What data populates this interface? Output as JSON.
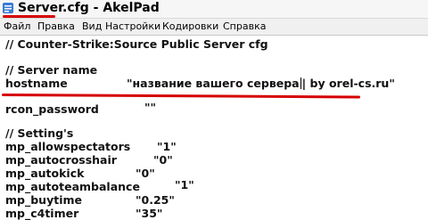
{
  "window": {
    "title_file": "Server.cfg",
    "title_sep": " - ",
    "title_app": "AkelPad",
    "accent_underline_color": "#d60000"
  },
  "menu": [
    "Файл",
    "Правка",
    "Вид",
    "Настройки",
    "Кодировки",
    "Справка"
  ],
  "editor": {
    "header_comment": "// Counter-Strike:Source Public Server cfg",
    "server_name_comment": "// Server name",
    "hostname_key": "hostname",
    "hostname_value_before_caret": "\"название вашего сервера",
    "hostname_value_after_caret": "| by orel-cs.ru\"",
    "rcon_key": "rcon_password",
    "rcon_value": "\"\"",
    "settings_comment": "// Setting's",
    "settings": [
      {
        "key": "mp_allowspectators",
        "value": "\"1\""
      },
      {
        "key": "mp_autocrosshair",
        "value": "\"0\""
      },
      {
        "key": "mp_autokick",
        "value": "\"0\""
      },
      {
        "key": "mp_autoteambalance",
        "value": "\"1\""
      },
      {
        "key": "mp_buytime",
        "value": "\"0.25\""
      },
      {
        "key": "mp_c4timer",
        "value": "\"35\""
      }
    ]
  }
}
